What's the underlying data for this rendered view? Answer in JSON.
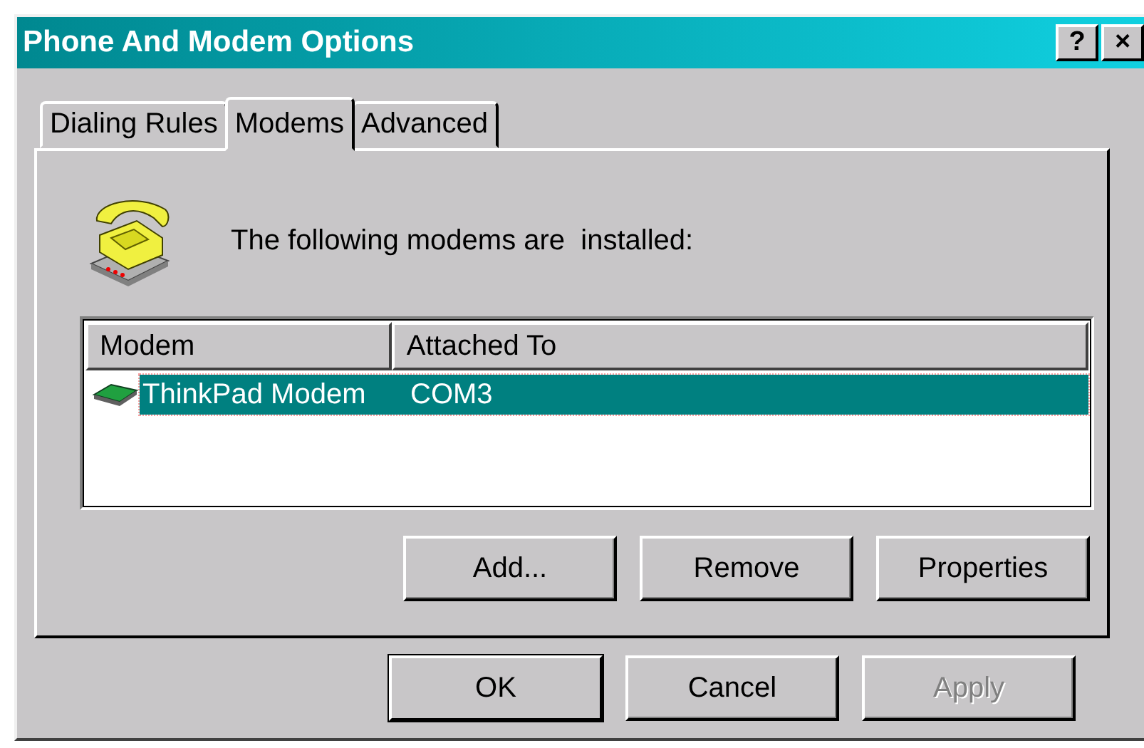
{
  "window": {
    "title": "Phone And Modem Options",
    "title_buttons": [
      "?",
      "×"
    ]
  },
  "tabs": [
    {
      "label": "Dialing Rules",
      "selected": false
    },
    {
      "label": "Modems",
      "selected": true
    },
    {
      "label": "Advanced",
      "selected": false
    }
  ],
  "intro": "The following modems are  installed:",
  "table": {
    "columns": [
      "Modem",
      "Attached To"
    ],
    "rows": [
      {
        "cells": [
          "ThinkPad Modem",
          "COM3"
        ],
        "selected": true
      }
    ]
  },
  "panel_buttons": [
    {
      "label": "Add...",
      "disabled": false
    },
    {
      "label": "Remove",
      "disabled": false
    },
    {
      "label": "Properties",
      "disabled": false
    }
  ],
  "dialog_buttons": [
    {
      "label": "OK",
      "disabled": false,
      "default": true
    },
    {
      "label": "Cancel",
      "disabled": false,
      "default": false
    },
    {
      "label": "Apply",
      "disabled": true,
      "default": false
    }
  ]
}
